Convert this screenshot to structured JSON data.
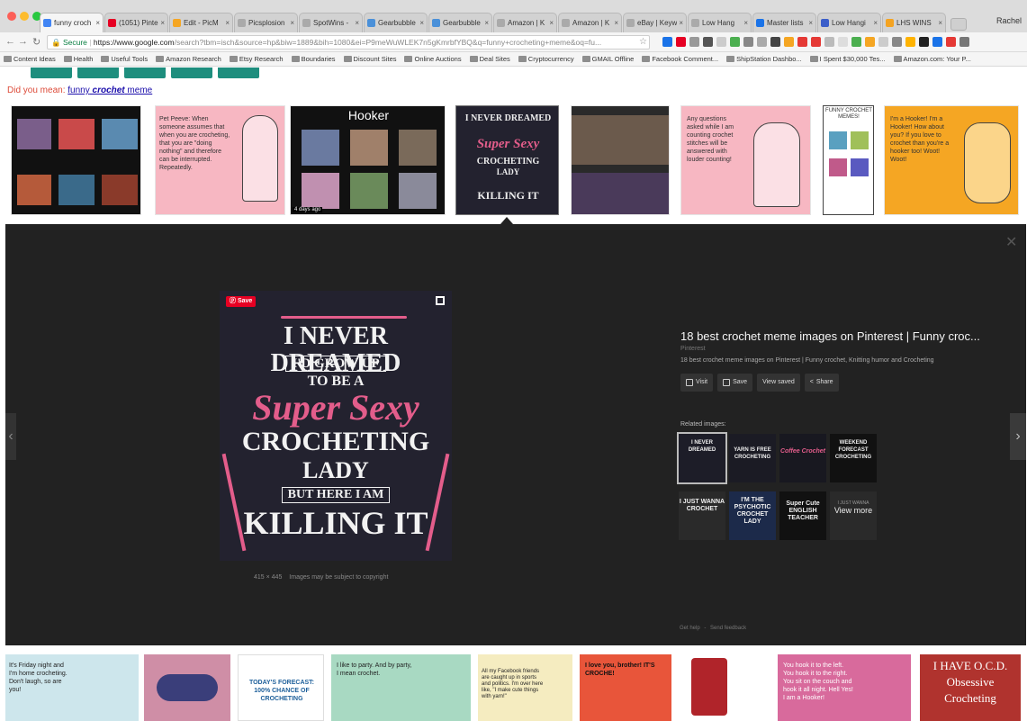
{
  "browser": {
    "tabs": [
      {
        "label": "funny croch",
        "favicon_color": "#4285f4",
        "active": true
      },
      {
        "label": "(1051) Pinte",
        "favicon_color": "#e60023",
        "active": false
      },
      {
        "label": "Edit - PicM",
        "favicon_color": "#f5a623",
        "active": false
      },
      {
        "label": "Picsplosion",
        "favicon_color": "#aaaaaa",
        "active": false
      },
      {
        "label": "SpotWins -",
        "favicon_color": "#aaaaaa",
        "active": false
      },
      {
        "label": "Gearbubble",
        "favicon_color": "#4a90d9",
        "active": false
      },
      {
        "label": "Gearbubble",
        "favicon_color": "#4a90d9",
        "active": false
      },
      {
        "label": "Amazon | K",
        "favicon_color": "#aaaaaa",
        "active": false
      },
      {
        "label": "Amazon | K",
        "favicon_color": "#aaaaaa",
        "active": false
      },
      {
        "label": "eBay | Keyw",
        "favicon_color": "#aaaaaa",
        "active": false
      },
      {
        "label": "Low Hang",
        "favicon_color": "#aaaaaa",
        "active": false
      },
      {
        "label": "Master lists",
        "favicon_color": "#1a73e8",
        "active": false
      },
      {
        "label": "Low Hangi",
        "favicon_color": "#3b5ec9",
        "active": false
      },
      {
        "label": "LHS WINS",
        "favicon_color": "#f4a321",
        "active": false
      }
    ],
    "profile": "Rachel",
    "url_secure": "Secure",
    "url_host": "https://www.google.com",
    "url_path": "/search?tbm=isch&source=hp&biw=1889&bih=1080&ei=P9meWuWLEK7n5gKmrbfYBQ&q=funny+crocheting+meme&oq=fu..."
  },
  "bookmarks": [
    "Content Ideas",
    "Health",
    "Useful Tools",
    "Amazon Research",
    "Etsy Research",
    "Boundaries",
    "Discount Sites",
    "Online Auctions",
    "Deal Sites",
    "Cryptocurrency",
    "GMAIL Offline",
    "Facebook Comment...",
    "ShipStation Dashbo...",
    "I Spent $30,000 Tes...",
    "Amazon.com: Your P..."
  ],
  "search": {
    "did_you_mean_prefix": "Did you mean:",
    "did_you_mean_word1": "funny",
    "did_you_mean_word2": "crochet",
    "did_you_mean_word3": "meme"
  },
  "results_row1": [
    {
      "caption": "Hooker",
      "badge": "4 days ago"
    },
    {
      "caption": "Pet Peeve: When someone assumes that when you are crocheting, that you are \"doing nothing\" and therefore can be interrupted. Repeatedly."
    },
    {
      "caption": "Any questions asked while I am counting crochet stitches will be answered with louder counting!"
    },
    {
      "caption": "I'm a Hooker! I'm a Hooker! How about you? If you love to crochet than you're a hooker too! Woot! Woot!"
    },
    {
      "caption": "FUNNY CROCHET MEMES!"
    }
  ],
  "preview": {
    "save_label": "Save",
    "poster_line1": "I NEVER DREAMED",
    "poster_line2": "I'D GROW UP",
    "poster_line3": "TO BE A",
    "poster_line4": "Super Sexy",
    "poster_line5": "CROCHETING",
    "poster_line6": "LADY",
    "poster_line7": "BUT HERE I AM",
    "poster_line8": "KILLING IT",
    "dimensions": "415 × 445",
    "copyright": "Images may be subject to copyright",
    "title": "18 best crochet meme images on Pinterest | Funny croc...",
    "source": "Pinterest",
    "description": "18 best crochet meme images on Pinterest | Funny crochet, Knitting humor and Crocheting",
    "actions": {
      "visit": "Visit",
      "save": "Save",
      "view_saved": "View saved",
      "share": "Share"
    },
    "related_label": "Related images:",
    "view_more": "View more",
    "get_help": "Get help",
    "send_feedback": "Send feedback"
  },
  "related_texts": [
    "I NEVER DREAMED",
    "YARN IS FREE CROCHETING",
    "Coffee Crochet",
    "WEEKEND FORECAST CROCHETING",
    "I JUST WANNA CROCHET",
    "I'M THE PSYCHOTIC CROCHET LADY",
    "Super Cute ENGLISH TEACHER",
    "I JUST WANNA"
  ],
  "results_row2": [
    {
      "caption": "It's Friday night and I'm home crocheting. Don't laugh, so are you!"
    },
    {
      "caption": "TODAY'S FORECAST: 100% CHANCE OF CROCHETING"
    },
    {
      "caption": "I like to party. And by party, I mean crochet."
    },
    {
      "caption": "All my Facebook friends are caught up in sports and politics. I'm over here like, \"I make cute things with yarn!\""
    },
    {
      "caption": "I love you, brother! IT'S CROCHE!"
    },
    {
      "caption": "You hook it to the left. You hook it to the right. You sit on the couch and hook it all night. Hell Yes! I am a Hooker!"
    },
    {
      "caption": "I HAVE O.C.D. Obsessive Crocheting"
    }
  ],
  "colors": {
    "panel_bg": "#222222",
    "chip_teal": "#1e8e7e",
    "accent_pink": "#e35d8b",
    "pinterest_red": "#e60023"
  }
}
